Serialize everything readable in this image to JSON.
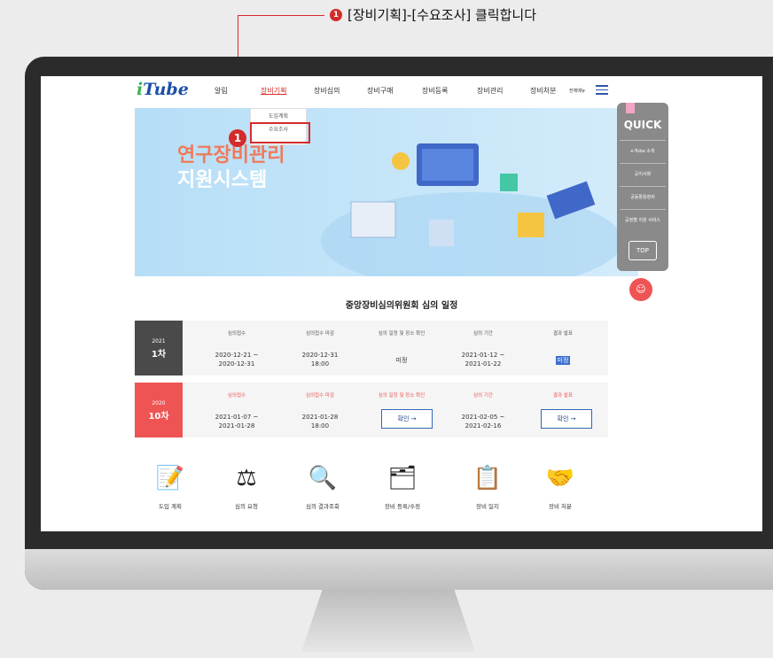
{
  "instruction": {
    "step": "1",
    "text": "[장비기획]-[수요조사] 클릭합니다"
  },
  "header": {
    "logo": "Tube",
    "menu": [
      "알림",
      "장비기획",
      "장비심의",
      "장비구매",
      "장비등록",
      "장비관리",
      "장비처분"
    ],
    "all_menu": "전체메뉴"
  },
  "dropdown": [
    "도입계획",
    "수요조사"
  ],
  "badge": "1",
  "hero": {
    "line1": "연구장비관리",
    "line2": "지원시스템"
  },
  "quick": {
    "title": "QUICK",
    "items": [
      "e-Tube 소개",
      "공지사항",
      "공동활용장비",
      "공정별 지원 서비스"
    ],
    "top": "TOP"
  },
  "schedule": {
    "title": "중앙장비심의위원회 심의 일정",
    "headers": [
      "심의접수",
      "심의접수 마감",
      "심의 일정 및 장소 확인",
      "심의 기간",
      "결과 발표"
    ],
    "rows": [
      {
        "year": "2021",
        "round": "1차",
        "reception": "2020-12-21 ~\n2020-12-31",
        "deadline": "2020-12-31\n18:00",
        "place": "미정",
        "period": "2021-01-12 ~\n2021-01-22",
        "result": "미정"
      },
      {
        "year": "2020",
        "round": "10차",
        "reception": "2021-01-07 ~\n2021-01-28",
        "deadline": "2021-01-28\n18:00",
        "place": "확인 →",
        "period": "2021-02-05 ~\n2021-02-16",
        "result": "확인 →"
      }
    ]
  },
  "shortcuts": [
    "도입 계획",
    "심의 요청",
    "심의 결과조회",
    "장비 등록/수정",
    "장비 일지",
    "장비 처분"
  ],
  "colors": {
    "accent": "#d42b2b",
    "brand": "#1d4fa5",
    "row1": "#4a4a4a",
    "row2": "#ef5454"
  }
}
